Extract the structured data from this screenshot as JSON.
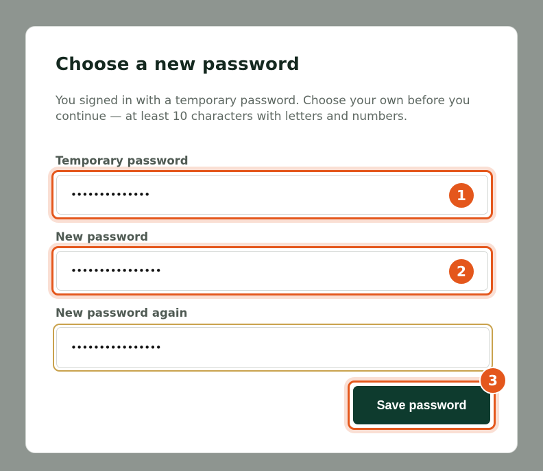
{
  "dialog": {
    "title": "Choose a new password",
    "description": "You signed in with a temporary password. Choose your own before you continue — at least 10 characters with letters and numbers."
  },
  "fields": [
    {
      "label": "Temporary password",
      "masked_value": "••••••••••••••",
      "badge": "1"
    },
    {
      "label": "New password",
      "masked_value": "••••••••••••••••",
      "badge": "2"
    },
    {
      "label": "New password again",
      "masked_value": "••••••••••••••••"
    }
  ],
  "save_button": {
    "label": "Save password",
    "badge": "3"
  },
  "colors": {
    "backdrop": "#8e9590",
    "primary": "#0e3b2e",
    "highlight": "#e4571c",
    "focus_border": "#c9a24d",
    "title": "#14281f"
  }
}
